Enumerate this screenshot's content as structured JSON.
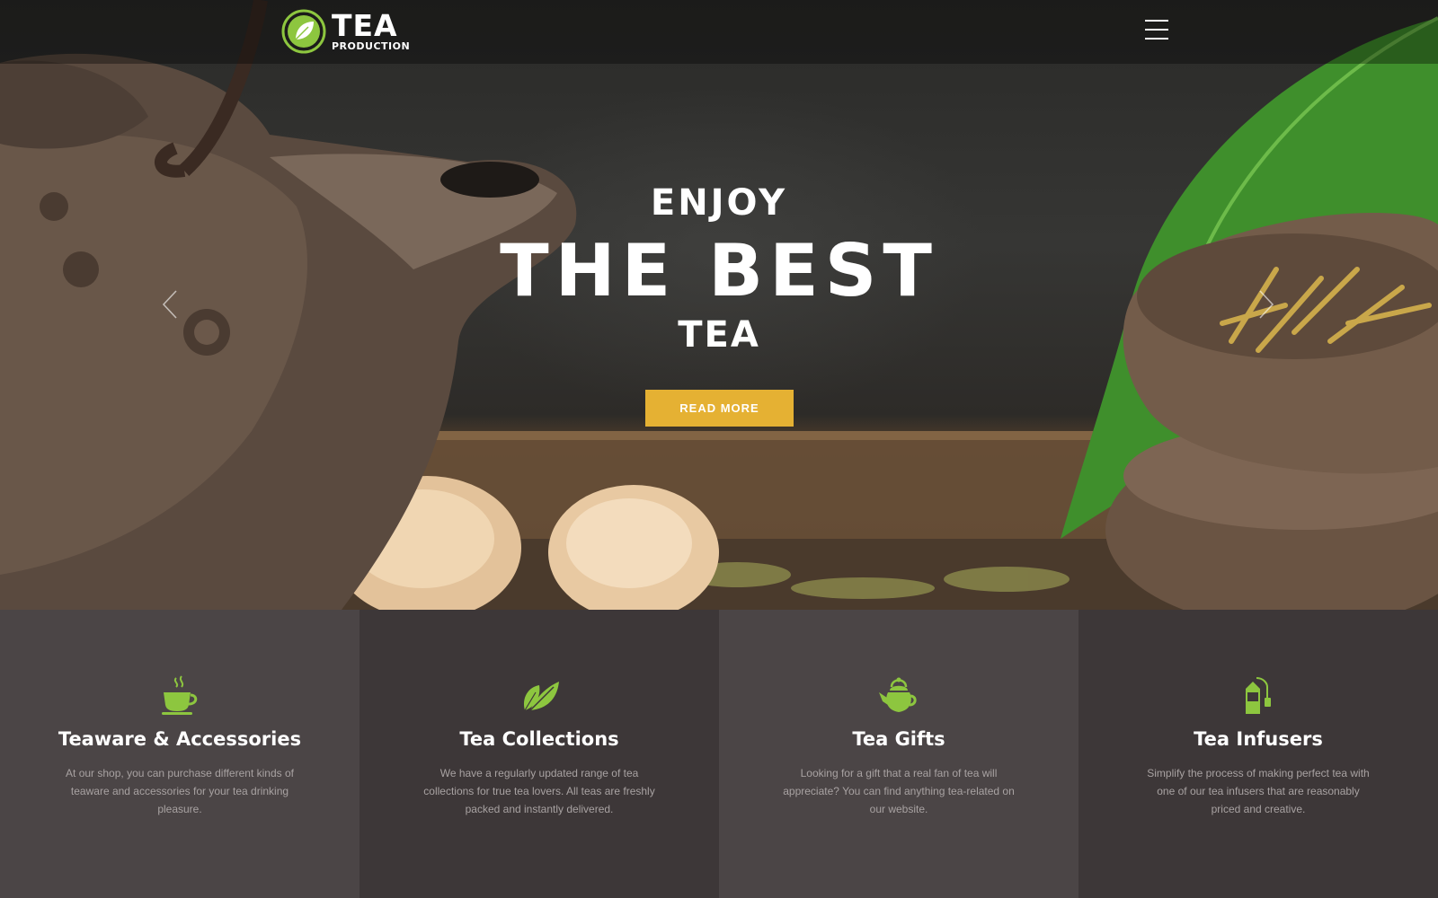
{
  "brand": {
    "name": "TEA",
    "tagline": "PRODUCTION"
  },
  "colors": {
    "accent_green": "#8dc63f",
    "cta_yellow": "#e5b133",
    "panel_light": "#4b4546",
    "panel_dark": "#3d3738"
  },
  "header": {
    "menu_icon": "hamburger-menu-icon"
  },
  "hero": {
    "line1": "ENJOY",
    "line2": "THE BEST",
    "line3": "TEA",
    "cta_label": "READ MORE",
    "prev_icon": "chevron-left-icon",
    "next_icon": "chevron-right-icon"
  },
  "features": [
    {
      "icon": "tea-cup-icon",
      "title": "Teaware & Accessories",
      "description": "At our shop, you can purchase different kinds of teaware and accessories for your tea drinking pleasure."
    },
    {
      "icon": "tea-leaf-icon",
      "title": "Tea Collections",
      "description": "We have a regularly updated range of tea collections for true tea lovers. All teas are freshly packed and instantly delivered."
    },
    {
      "icon": "teapot-icon",
      "title": "Tea Gifts",
      "description": "Looking for a gift that a real fan of tea will appreciate? You can find anything tea-related on our website."
    },
    {
      "icon": "tea-bag-icon",
      "title": "Tea Infusers",
      "description": "Simplify the process of making perfect tea with one of our tea infusers that are reasonably priced and creative."
    }
  ]
}
